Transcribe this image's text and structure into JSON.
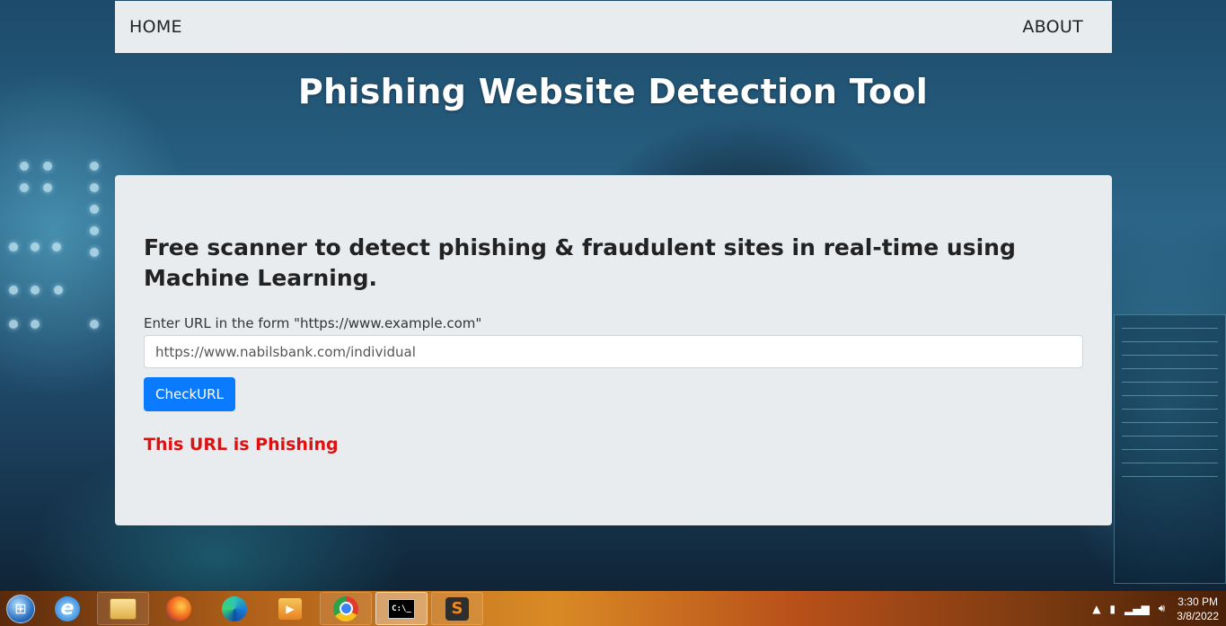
{
  "nav": {
    "home_label": "HOME",
    "about_label": "ABOUT"
  },
  "hero": {
    "title": "Phishing Website Detection Tool"
  },
  "card": {
    "lead": "Free scanner to detect phishing & fraudulent sites in real-time using Machine Learning.",
    "url_label": "Enter URL in the form \"https://www.example.com\"",
    "url_value": "https://www.nabilsbank.com/individual",
    "check_button": "CheckURL",
    "result": "This URL is Phishing"
  },
  "colors": {
    "button": "#0a7bff",
    "result": "#e01010",
    "panel": "#e9ecef"
  },
  "taskbar": {
    "items": [
      "start-orb",
      "internet-explorer",
      "file-explorer",
      "firefox",
      "edge",
      "media-player",
      "chrome",
      "command-prompt",
      "sublime-text"
    ],
    "time": "3:30 PM",
    "date": "3/8/2022"
  }
}
